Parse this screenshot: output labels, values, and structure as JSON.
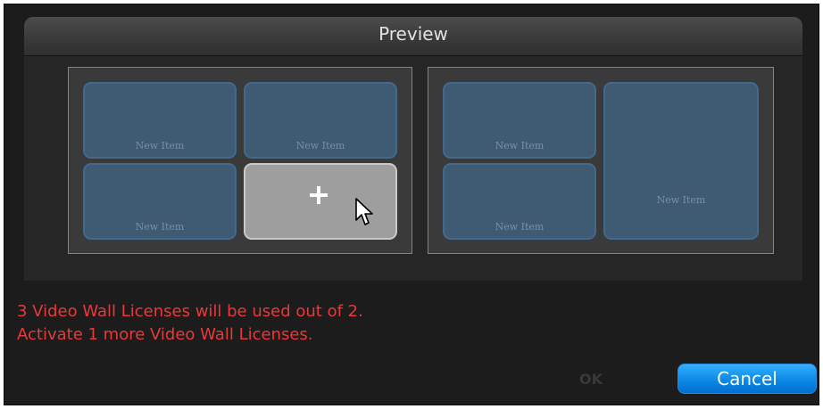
{
  "preview": {
    "title": "Preview",
    "left_layout": {
      "tiles": [
        {
          "label": "New Item"
        },
        {
          "label": "New Item"
        },
        {
          "label": "New Item"
        }
      ],
      "add_tile": {
        "icon": "plus-icon",
        "cursor": "arrow-cursor-icon"
      }
    },
    "right_layout": {
      "tiles": [
        {
          "label": "New Item"
        },
        {
          "label": "New Item"
        },
        {
          "label": "New Item"
        }
      ]
    }
  },
  "warning": {
    "line1": "3 Video Wall Licenses will be used out of 2.",
    "line2": "Activate 1 more Video Wall Licenses.",
    "color": "#e8393a"
  },
  "buttons": {
    "ok_label": "OK",
    "ok_enabled": false,
    "cancel_label": "Cancel",
    "accent": "#0d89e6"
  }
}
